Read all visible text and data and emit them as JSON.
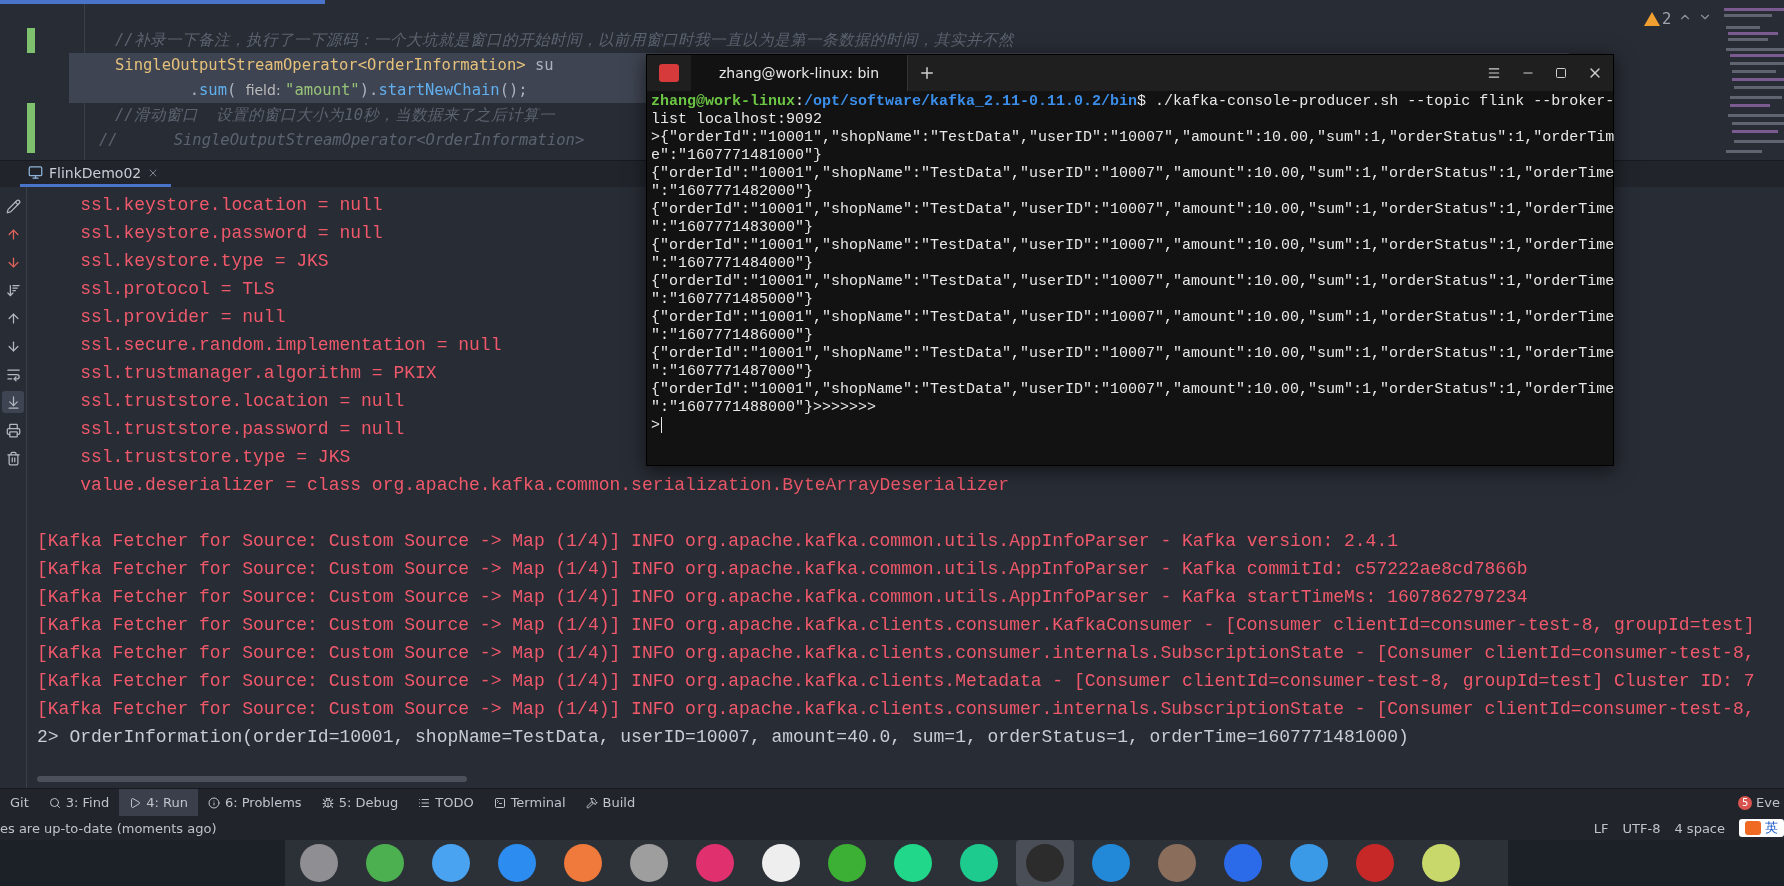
{
  "editor": {
    "lines": [
      {
        "changed": true,
        "selected": false,
        "tokens": [
          {
            "kind": "comment",
            "text": "//补录一下备注，执行了一下源码：一个大坑就是窗口的开始时间，以前用窗口时我一直以为是第一条数据的时间，其实并不然"
          }
        ]
      },
      {
        "changed": false,
        "selected": true,
        "tokens": [
          {
            "kind": "type",
            "text": "SingleOutputStreamOperator<OrderInformation>"
          },
          {
            "kind": "plain",
            "text": " su"
          }
        ]
      },
      {
        "changed": false,
        "selected": true,
        "tokens": [
          {
            "kind": "plain",
            "text": "        ."
          },
          {
            "kind": "method",
            "text": "sum"
          },
          {
            "kind": "plain",
            "text": "( "
          },
          {
            "kind": "hint",
            "text": "field: "
          },
          {
            "kind": "string",
            "text": "\"amount\""
          },
          {
            "kind": "plain",
            "text": ")."
          },
          {
            "kind": "method",
            "text": "startNewChain"
          },
          {
            "kind": "plain",
            "text": "();"
          }
        ]
      },
      {
        "changed": true,
        "selected": false,
        "tokens": [
          {
            "kind": "comment",
            "text": "//滑动窗口  设置的窗口大小为10秒，当数据来了之后计算一"
          }
        ]
      },
      {
        "changed": true,
        "selected": false,
        "outdent": true,
        "tokens": [
          {
            "kind": "comment",
            "text": "//      SingleOutputStreamOperator<OrderInformation>"
          }
        ]
      }
    ],
    "inspections": {
      "count": "2"
    }
  },
  "run_tab": {
    "label": "FlinkDemo02"
  },
  "console": {
    "tools": [
      {
        "kind": "edit",
        "selected": false
      },
      {
        "kind": "prev-error",
        "selected": false
      },
      {
        "kind": "next-error",
        "selected": false
      },
      {
        "kind": "sort",
        "selected": false
      },
      {
        "kind": "up",
        "selected": false
      },
      {
        "kind": "down",
        "selected": false
      },
      {
        "kind": "wrap",
        "selected": false
      },
      {
        "kind": "scroll-end",
        "selected": true
      },
      {
        "kind": "print",
        "selected": false
      },
      {
        "kind": "clear",
        "selected": false
      }
    ],
    "lines": [
      {
        "kind": "error",
        "text": "    ssl.keystore.location = null"
      },
      {
        "kind": "error",
        "text": "    ssl.keystore.password = null"
      },
      {
        "kind": "error",
        "text": "    ssl.keystore.type = JKS"
      },
      {
        "kind": "error",
        "text": "    ssl.protocol = TLS"
      },
      {
        "kind": "error",
        "text": "    ssl.provider = null"
      },
      {
        "kind": "error",
        "text": "    ssl.secure.random.implementation = null"
      },
      {
        "kind": "error",
        "text": "    ssl.trustmanager.algorithm = PKIX"
      },
      {
        "kind": "error",
        "text": "    ssl.truststore.location = null"
      },
      {
        "kind": "error",
        "text": "    ssl.truststore.password = null"
      },
      {
        "kind": "error",
        "text": "    ssl.truststore.type = JKS"
      },
      {
        "kind": "error",
        "text": "    value.deserializer = class org.apache.kafka.common.serialization.ByteArrayDeserializer"
      },
      {
        "kind": "blank"
      },
      {
        "kind": "error",
        "text": "[Kafka Fetcher for Source: Custom Source -> Map (1/4)] INFO org.apache.kafka.common.utils.AppInfoParser - Kafka version: 2.4.1"
      },
      {
        "kind": "error",
        "text": "[Kafka Fetcher for Source: Custom Source -> Map (1/4)] INFO org.apache.kafka.common.utils.AppInfoParser - Kafka commitId: c57222ae8cd7866b"
      },
      {
        "kind": "error",
        "text": "[Kafka Fetcher for Source: Custom Source -> Map (1/4)] INFO org.apache.kafka.common.utils.AppInfoParser - Kafka startTimeMs: 1607862797234"
      },
      {
        "kind": "error",
        "text": "[Kafka Fetcher for Source: Custom Source -> Map (1/4)] INFO org.apache.kafka.clients.consumer.KafkaConsumer - [Consumer clientId=consumer-test-8, groupId=test]"
      },
      {
        "kind": "error",
        "text": "[Kafka Fetcher for Source: Custom Source -> Map (1/4)] INFO org.apache.kafka.clients.consumer.internals.SubscriptionState - [Consumer clientId=consumer-test-8,"
      },
      {
        "kind": "error",
        "text": "[Kafka Fetcher for Source: Custom Source -> Map (1/4)] INFO org.apache.kafka.clients.Metadata - [Consumer clientId=consumer-test-8, groupId=test] Cluster ID: 7"
      },
      {
        "kind": "error",
        "text": "[Kafka Fetcher for Source: Custom Source -> Map (1/4)] INFO org.apache.kafka.clients.consumer.internals.SubscriptionState - [Consumer clientId=consumer-test-8,"
      },
      {
        "kind": "output",
        "text": "2> OrderInformation(orderId=10001, shopName=TestData, userID=10007, amount=40.0, sum=1, orderStatus=1, orderTime=1607771481000)"
      }
    ]
  },
  "tool_strip": {
    "items": [
      {
        "kind": "git",
        "label": "Git",
        "selected": false
      },
      {
        "kind": "find",
        "label": "3: Find",
        "selected": false
      },
      {
        "kind": "run",
        "label": "4: Run",
        "selected": true
      },
      {
        "kind": "problems",
        "label": "6: Problems",
        "selected": false
      },
      {
        "kind": "debug",
        "label": "5: Debug",
        "selected": false
      },
      {
        "kind": "todo",
        "label": "TODO",
        "selected": false
      },
      {
        "kind": "terminal",
        "label": "Terminal",
        "selected": false
      },
      {
        "kind": "build",
        "label": "Build",
        "selected": false
      }
    ],
    "event_log": {
      "badge": "5",
      "label": "Eve"
    }
  },
  "status_bar": {
    "message": "es are up-to-date (moments ago)",
    "items": [
      "LF",
      "UTF-8",
      "4 space"
    ],
    "ime": "英"
  },
  "terminal": {
    "tab": "zhang@work-linux: bin",
    "prompt": {
      "user_host": "zhang@work-linux",
      "separator": ":",
      "path": "/opt/software/kafka_2.11-0.11.0.2/bin",
      "command": "$ ./kafka-console-producer.sh --topic flink --broker-"
    },
    "lines": [
      "list localhost:9092",
      ">{\"orderId\":\"10001\",\"shopName\":\"TestData\",\"userID\":\"10007\",\"amount\":10.00,\"sum\":1,\"orderStatus\":1,\"orderTim",
      "e\":\"1607771481000\"}",
      "{\"orderId\":\"10001\",\"shopName\":\"TestData\",\"userID\":\"10007\",\"amount\":10.00,\"sum\":1,\"orderStatus\":1,\"orderTime",
      "\":\"1607771482000\"}",
      "{\"orderId\":\"10001\",\"shopName\":\"TestData\",\"userID\":\"10007\",\"amount\":10.00,\"sum\":1,\"orderStatus\":1,\"orderTime",
      "\":\"1607771483000\"}",
      "{\"orderId\":\"10001\",\"shopName\":\"TestData\",\"userID\":\"10007\",\"amount\":10.00,\"sum\":1,\"orderStatus\":1,\"orderTime",
      "\":\"1607771484000\"}",
      "{\"orderId\":\"10001\",\"shopName\":\"TestData\",\"userID\":\"10007\",\"amount\":10.00,\"sum\":1,\"orderStatus\":1,\"orderTime",
      "\":\"1607771485000\"}",
      "{\"orderId\":\"10001\",\"shopName\":\"TestData\",\"userID\":\"10007\",\"amount\":10.00,\"sum\":1,\"orderStatus\":1,\"orderTime",
      "\":\"1607771486000\"}",
      "{\"orderId\":\"10001\",\"shopName\":\"TestData\",\"userID\":\"10007\",\"amount\":10.00,\"sum\":1,\"orderStatus\":1,\"orderTime",
      "\":\"1607771487000\"}",
      "{\"orderId\":\"10001\",\"shopName\":\"TestData\",\"userID\":\"10007\",\"amount\":10.00,\"sum\":1,\"orderStatus\":1,\"orderTime",
      "\":\"1607771488000\"}>>>>>>>",
      ">"
    ]
  },
  "dock": {
    "items": [
      {
        "color": "#8e8e93",
        "selected": false
      },
      {
        "color": "#4caf50",
        "selected": false
      },
      {
        "color": "#4aa3f0",
        "selected": false
      },
      {
        "color": "#2d8cf0",
        "selected": false
      },
      {
        "color": "#f07a3c",
        "selected": false
      },
      {
        "color": "#9e9e9e",
        "selected": false
      },
      {
        "color": "#e0316e",
        "selected": false
      },
      {
        "color": "#eeeeee",
        "selected": false
      },
      {
        "color": "#3cb034",
        "selected": false
      },
      {
        "color": "#21d789",
        "selected": false
      },
      {
        "color": "#1ecb8f",
        "selected": false
      },
      {
        "color": "#2c2c2c",
        "selected": true
      },
      {
        "color": "#2289d8",
        "selected": false
      },
      {
        "color": "#8a6d5a",
        "selected": false
      },
      {
        "color": "#2b6be9",
        "selected": false
      },
      {
        "color": "#3a9ae8",
        "selected": false
      },
      {
        "color": "#c62828",
        "selected": false
      },
      {
        "color": "#c9d86a",
        "selected": false
      }
    ]
  }
}
